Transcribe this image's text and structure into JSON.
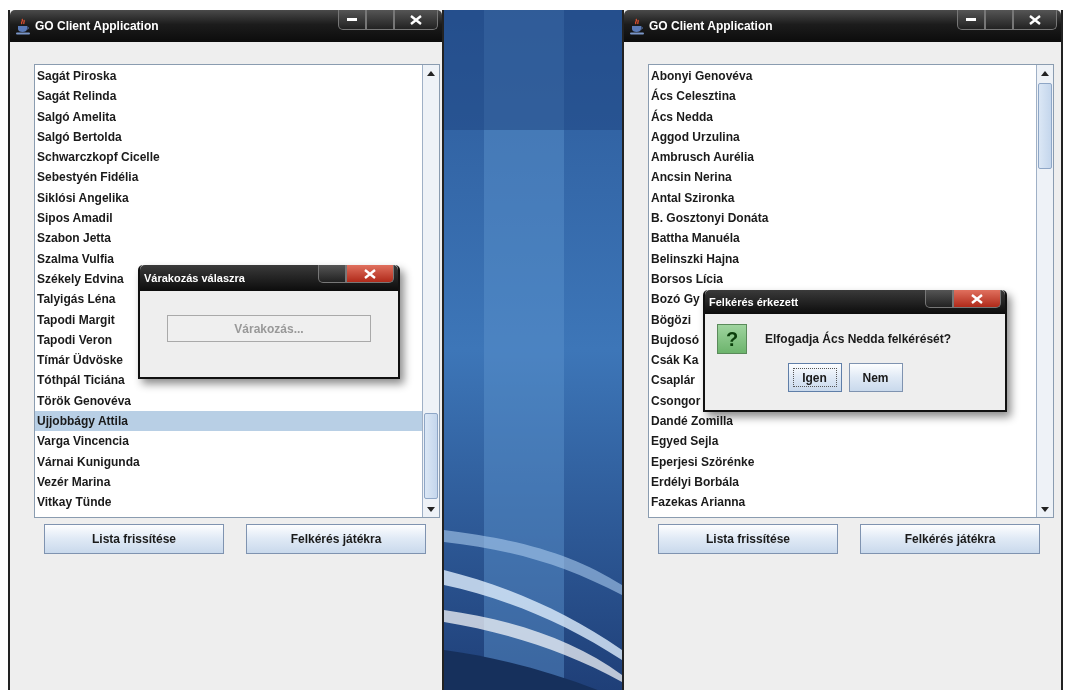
{
  "windows": [
    {
      "title": "GO Client Application",
      "list": [
        {
          "name": "Sagát Piroska",
          "selected": false
        },
        {
          "name": "Sagát Relinda",
          "selected": false
        },
        {
          "name": "Salgó Amelita",
          "selected": false
        },
        {
          "name": "Salgó Bertolda",
          "selected": false
        },
        {
          "name": "Schwarczkopf Cicelle",
          "selected": false
        },
        {
          "name": "Sebestyén Fidélia",
          "selected": false
        },
        {
          "name": "Siklósi Angelika",
          "selected": false
        },
        {
          "name": "Sipos Amadil",
          "selected": false
        },
        {
          "name": "Szabon Jetta",
          "selected": false
        },
        {
          "name": "Szalma Vulfia",
          "selected": false
        },
        {
          "name": "Székely Edvina",
          "selected": false
        },
        {
          "name": "Talyigás Léna",
          "selected": false
        },
        {
          "name": "Tapodi Margit",
          "selected": false
        },
        {
          "name": "Tapodi Veron",
          "selected": false
        },
        {
          "name": "Tímár Üdvöske",
          "selected": false
        },
        {
          "name": "Tóthpál Ticiána",
          "selected": false
        },
        {
          "name": "Török Genovéva",
          "selected": false
        },
        {
          "name": "Ujjobbágy Attila",
          "selected": true
        },
        {
          "name": "Varga Vincencia",
          "selected": false
        },
        {
          "name": "Várnai Kunigunda",
          "selected": false
        },
        {
          "name": "Vezér Marina",
          "selected": false
        },
        {
          "name": "Vitkay Tünde",
          "selected": false
        }
      ],
      "buttons": [
        "Lista frissítése",
        "Felkérés játékra"
      ],
      "dialog": {
        "kind": "waiting",
        "title": "Várakozás válaszra",
        "status": "Várakozás..."
      }
    },
    {
      "title": "GO Client Application",
      "list": [
        {
          "name": "Abonyi Genovéva",
          "selected": false
        },
        {
          "name": "Ács Celesztina",
          "selected": false
        },
        {
          "name": "Ács Nedda",
          "selected": false
        },
        {
          "name": "Aggod Urzulina",
          "selected": false
        },
        {
          "name": "Ambrusch Aurélia",
          "selected": false
        },
        {
          "name": "Ancsin Nerina",
          "selected": false
        },
        {
          "name": "Antal Szironka",
          "selected": false
        },
        {
          "name": "B. Gosztonyi Donáta",
          "selected": false
        },
        {
          "name": "Battha Manuéla",
          "selected": false
        },
        {
          "name": "Belinszki Hajna",
          "selected": false
        },
        {
          "name": "Borsos Lícia",
          "selected": false
        },
        {
          "name": "Bozó Gy",
          "selected": false
        },
        {
          "name": "Bögözi",
          "selected": false
        },
        {
          "name": "Bujdosó",
          "selected": false
        },
        {
          "name": "Csák Ka",
          "selected": false
        },
        {
          "name": "Csaplár",
          "selected": false
        },
        {
          "name": "Csongor",
          "selected": false
        },
        {
          "name": "Dandé Zomilla",
          "selected": false
        },
        {
          "name": "Egyed Sejla",
          "selected": false
        },
        {
          "name": "Eperjesi Szörénke",
          "selected": false
        },
        {
          "name": "Erdélyi Borbála",
          "selected": false
        },
        {
          "name": "Fazekas Arianna",
          "selected": false
        }
      ],
      "buttons": [
        "Lista frissítése",
        "Felkérés játékra"
      ],
      "dialog": {
        "kind": "question",
        "title": "Felkérés érkezett",
        "icon_glyph": "?",
        "message": "Elfogadja Ács Nedda felkérését?",
        "buttons": [
          {
            "label": "Igen",
            "focused": true
          },
          {
            "label": "Nem",
            "focused": false
          }
        ]
      }
    }
  ]
}
